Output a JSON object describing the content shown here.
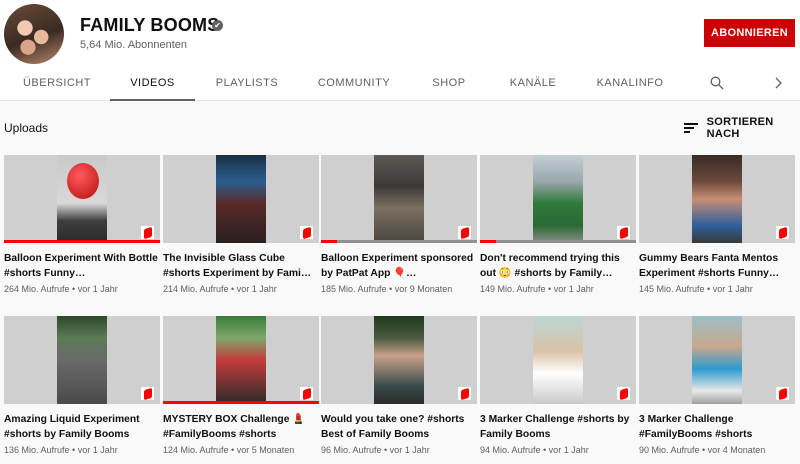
{
  "channel": {
    "name": "FAMILY BOOMS",
    "verified_mark": "✔",
    "subscribers": "5,64 Mio. Abonnenten",
    "subscribe_label": "ABONNIEREN"
  },
  "tabs": [
    {
      "label": "ÜBERSICHT"
    },
    {
      "label": "VIDEOS"
    },
    {
      "label": "PLAYLISTS"
    },
    {
      "label": "COMMUNITY"
    },
    {
      "label": "SHOP"
    },
    {
      "label": "KANÄLE"
    },
    {
      "label": "KANALINFO"
    }
  ],
  "icons": {
    "search": "search-icon",
    "next": "chevron-right-icon",
    "sort": "sort-icon",
    "shorts": "shorts-icon"
  },
  "section": {
    "title": "Uploads",
    "sort_label": "SORTIEREN NACH"
  },
  "colors": {
    "accent": "#cc0000",
    "shorts_red": "#ff0000"
  },
  "videos": [
    {
      "title": "Balloon Experiment With Bottle #shorts Funny…",
      "meta": "264 Mio. Aufrufe • vor 1 Jahr",
      "watched": 1.0
    },
    {
      "title": "The Invisible Glass Cube #shorts Experiment by Fami…",
      "meta": "214 Mio. Aufrufe • vor 1 Jahr",
      "watched": 0
    },
    {
      "title": "Balloon Experiment sponsored by PatPat App 🎈…",
      "meta": "185 Mio. Aufrufe • vor 9 Monaten",
      "watched": 0.1
    },
    {
      "title": "Don't recommend trying this out 😳 #shorts by Family…",
      "meta": "149 Mio. Aufrufe • vor 1 Jahr",
      "watched": 0.1
    },
    {
      "title": "Gummy Bears Fanta Mentos Experiment #shorts Funny…",
      "meta": "145 Mio. Aufrufe • vor 1 Jahr",
      "watched": 0
    },
    {
      "title": "Amazing Liquid Experiment #shorts by Family Booms",
      "meta": "136 Mio. Aufrufe • vor 1 Jahr",
      "watched": 0
    },
    {
      "title": "MYSTERY BOX Challenge 💄 #FamilyBooms #shorts",
      "meta": "124 Mio. Aufrufe • vor 5 Monaten",
      "watched": 1.0
    },
    {
      "title": "Would you take one? #shorts Best of Family Booms",
      "meta": "96 Mio. Aufrufe • vor 1 Jahr",
      "watched": 0
    },
    {
      "title": "3 Marker Challenge #shorts by Family Booms",
      "meta": "94 Mio. Aufrufe • vor 1 Jahr",
      "watched": 0
    },
    {
      "title": "3 Marker Challenge #FamilyBooms #shorts",
      "meta": "90 Mio. Aufrufe • vor 4 Monaten",
      "watched": 0
    }
  ]
}
